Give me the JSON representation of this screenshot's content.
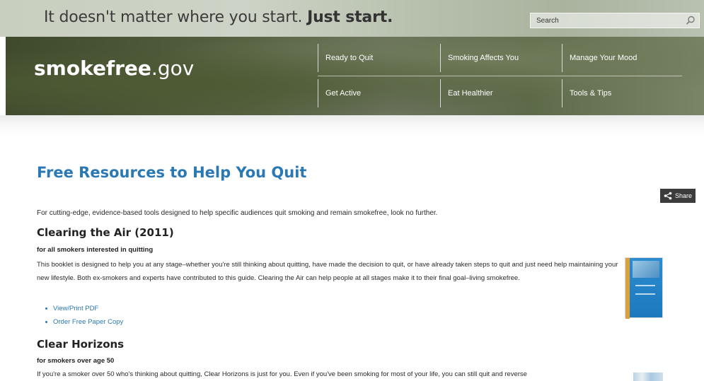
{
  "header": {
    "tagline_normal": "It doesn't matter where you start.",
    "tagline_bold": "Just start.",
    "search_placeholder": "Search",
    "logo_bold": "smokefree",
    "logo_light": ".gov",
    "nav": [
      {
        "label": "Ready to Quit"
      },
      {
        "label": "Smoking Affects You"
      },
      {
        "label": "Manage Your Mood"
      },
      {
        "label": "Get Active"
      },
      {
        "label": "Eat Healthier"
      },
      {
        "label": "Tools & Tips"
      }
    ]
  },
  "main": {
    "title": "Free Resources to Help You Quit",
    "share_label": "Share",
    "intro": "For cutting-edge, evidence-based tools designed to help specific audiences quit smoking and remain smokefree, look no further.",
    "sections": [
      {
        "title": "Clearing the Air (2011)",
        "subtitle": "for all smokers interested in quitting",
        "body": "This booklet is designed to help you at any stage–whether you're still thinking about quitting, have made the decision to quit, or have already taken steps to quit and just need help maintaining your new lifestyle. Both ex-smokers and experts have contributed to this guide. Clearing the Air can help people at all stages make it to their final goal–living smokefree.",
        "links": [
          "View/Print PDF",
          "Order Free Paper Copy"
        ]
      },
      {
        "title": "Clear Horizons",
        "subtitle": "for smokers over age 50",
        "body": "If you're a smoker over 50 who's thinking about quitting, Clear Horizons is just for you. Even if you've been smoking for most of your life, you can still quit and reverse"
      }
    ]
  },
  "colors": {
    "title_blue": "#2a79b5",
    "link_blue": "#2a79b5",
    "share_bg": "#3c3c3c"
  }
}
